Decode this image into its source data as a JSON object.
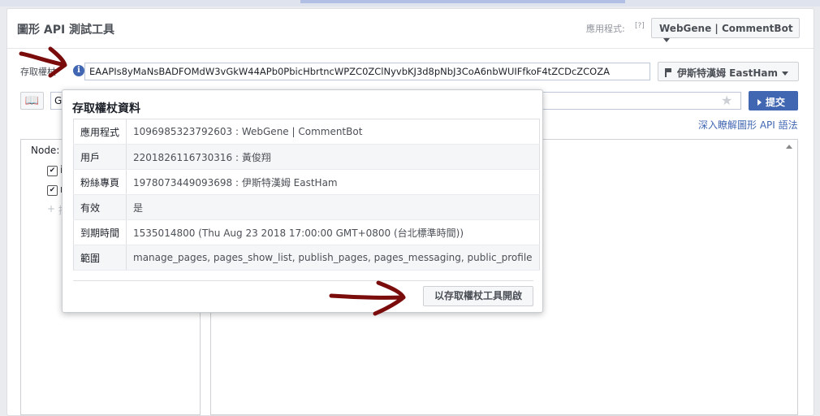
{
  "header": {
    "title": "圖形 API 測試工具",
    "app_label": "應用程式:",
    "help": "[?]",
    "app_select": "WebGene | CommentBot"
  },
  "token": {
    "label": "存取權杖",
    "info_icon": "i",
    "value": "EAAPIs8yMaNsBADFOMdW3vGkW44APb0PbicHbrtncWPZC0ZClNyvbKJ3d8pNbJ3CoA6nbWUIFfkoF4tZCDcZCOZA",
    "page_select": "伊斯特漢姆 EastHam"
  },
  "query": {
    "method_fragment": "G",
    "submit": "提交",
    "learn_link": "深入瞭解圖形 API 語法"
  },
  "left_pane": {
    "node_label": "Node:",
    "fields": [
      "i",
      "n"
    ],
    "add_text": "接"
  },
  "popover": {
    "title": "存取權杖資料",
    "rows": [
      {
        "key": "應用程式",
        "value": "1096985323792603 : WebGene | CommentBot"
      },
      {
        "key": "用戶",
        "value": "2201826116730316 : 黃俊翔"
      },
      {
        "key": "粉絲專頁",
        "value": "1978073449093698 : 伊斯特漢姆 EastHam"
      },
      {
        "key": "有效",
        "value": "是"
      },
      {
        "key": "到期時間",
        "value": "1535014800 (Thu Aug 23 2018 17:00:00 GMT+0800 (台北標準時間))"
      },
      {
        "key": "範圍",
        "value": "manage_pages, pages_show_list, publish_pages, pages_messaging, public_profile"
      }
    ],
    "open_button": "以存取權杖工具開啟"
  },
  "icons": {
    "book": "book-icon",
    "star": "star-icon",
    "info": "info-icon"
  },
  "colors": {
    "accent": "#4267b2",
    "annotation": "#7a0c0c"
  }
}
